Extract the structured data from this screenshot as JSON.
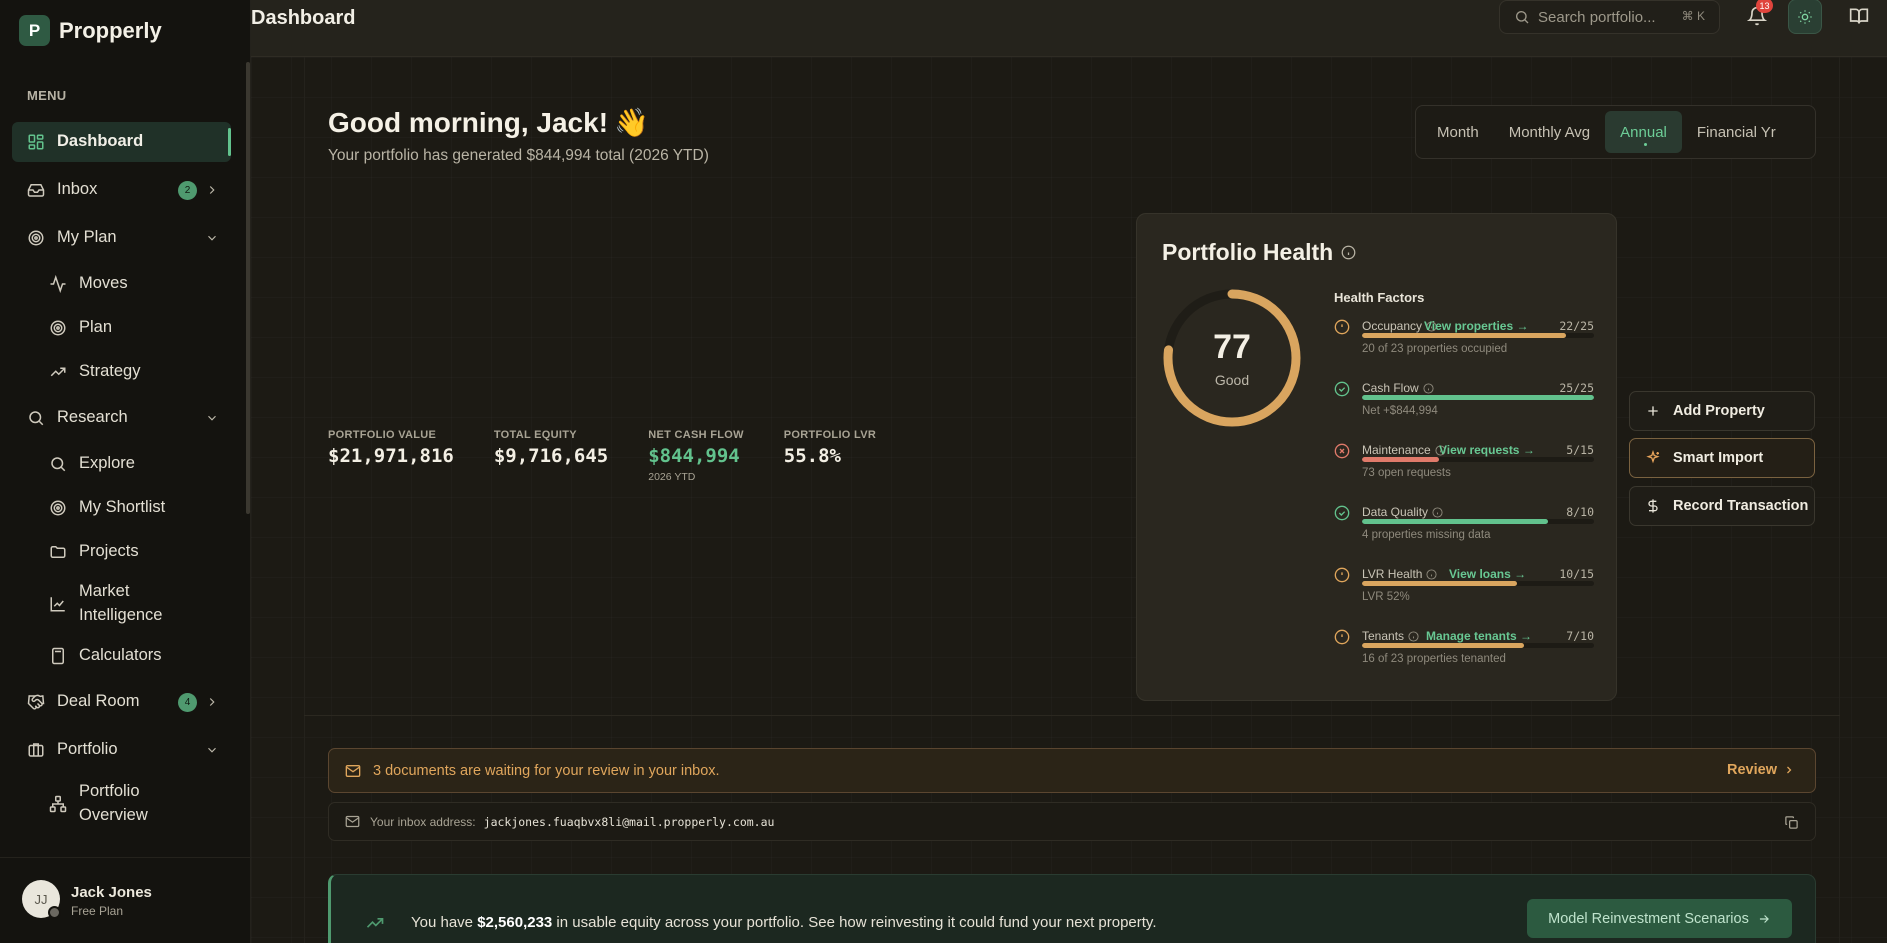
{
  "brand": {
    "logo_letter": "P",
    "name": "Propperly"
  },
  "sidebar": {
    "menu_label": "MENU",
    "items": [
      {
        "label": "Dashboard",
        "icon": "grid-icon"
      },
      {
        "label": "Inbox",
        "icon": "inbox-icon",
        "badge": "2"
      },
      {
        "label": "My Plan",
        "icon": "target-icon"
      },
      {
        "label": "Moves",
        "icon": "activity-icon"
      },
      {
        "label": "Plan",
        "icon": "target-icon"
      },
      {
        "label": "Strategy",
        "icon": "trending-up-icon"
      },
      {
        "label": "Research",
        "icon": "search-icon"
      },
      {
        "label": "Explore",
        "icon": "search-icon"
      },
      {
        "label": "My Shortlist",
        "icon": "target-icon"
      },
      {
        "label": "Projects",
        "icon": "folder-icon"
      },
      {
        "label": "Market Intelligence",
        "icon": "line-chart-icon"
      },
      {
        "label": "Calculators",
        "icon": "calculator-icon"
      },
      {
        "label": "Deal Room",
        "icon": "handshake-icon",
        "badge": "4"
      },
      {
        "label": "Portfolio",
        "icon": "briefcase-icon"
      },
      {
        "label": "Portfolio Overview",
        "icon": "network-icon"
      }
    ],
    "user": {
      "initials": "JJ",
      "name": "Jack Jones",
      "plan": "Free Plan"
    }
  },
  "header": {
    "title": "Dashboard",
    "search_placeholder": "Search portfolio...",
    "search_shortcut": "⌘ K",
    "notification_count": "13"
  },
  "greeting": {
    "title": "Good morning, Jack!",
    "emoji": "👋",
    "subtitle": "Your portfolio has generated $844,994 total (2026 YTD)"
  },
  "period_tabs": [
    "Month",
    "Monthly Avg",
    "Annual",
    "Financial Yr"
  ],
  "period_selected": "Annual",
  "stats": [
    {
      "label": "PORTFOLIO VALUE",
      "value": "$21,971,816"
    },
    {
      "label": "TOTAL EQUITY",
      "value": "$9,716,645"
    },
    {
      "label": "NET CASH FLOW",
      "value": "$844,994",
      "note": "2026 YTD"
    },
    {
      "label": "PORTFOLIO LVR",
      "value": "55.8%"
    }
  ],
  "health": {
    "title": "Portfolio Health",
    "score": "77",
    "score_fraction": 0.77,
    "score_label": "Good",
    "factors_title": "Health Factors",
    "factors": [
      {
        "name": "Occupancy",
        "link": "View properties →",
        "score": "22/25",
        "fraction": 0.88,
        "note": "20 of 23 properties occupied",
        "status": "warning"
      },
      {
        "name": "Cash Flow",
        "link": "",
        "score": "25/25",
        "fraction": 1.0,
        "note": "Net +$844,994",
        "status": "good"
      },
      {
        "name": "Maintenance",
        "link": "View requests →",
        "score": "5/15",
        "fraction": 0.33,
        "note": "73 open requests",
        "status": "bad"
      },
      {
        "name": "Data Quality",
        "link": "",
        "score": "8/10",
        "fraction": 0.8,
        "note": "4 properties missing data",
        "status": "good"
      },
      {
        "name": "LVR Health",
        "link": "View loans →",
        "score": "10/15",
        "fraction": 0.67,
        "note": "LVR 52%",
        "status": "warning"
      },
      {
        "name": "Tenants",
        "link": "Manage tenants →",
        "score": "7/10",
        "fraction": 0.7,
        "note": "16 of 23 properties tenanted",
        "status": "warning"
      }
    ]
  },
  "quick_actions": [
    {
      "label": "Add Property",
      "icon": "plus-icon"
    },
    {
      "label": "Smart Import",
      "icon": "sparkle-icon"
    },
    {
      "label": "Record Transaction",
      "icon": "dollar-icon"
    }
  ],
  "alert": {
    "text": "3 documents are waiting for your review in your inbox.",
    "action": "Review"
  },
  "inbox_address": {
    "label": "Your inbox address:",
    "address": "jackjones.fuaqbvx8li@mail.propperly.com.au"
  },
  "equity": {
    "prefix": "You have ",
    "amount": "$2,560,233",
    "suffix": " in usable equity across your portfolio. See how reinvesting it could fund your next property.",
    "cta": "Model Reinvestment Scenarios"
  },
  "colors": {
    "accent_green": "#62c28d",
    "warning_amber": "#e0a65c",
    "danger_red": "#e07a6a",
    "gauge_color": "#d9a55f"
  }
}
